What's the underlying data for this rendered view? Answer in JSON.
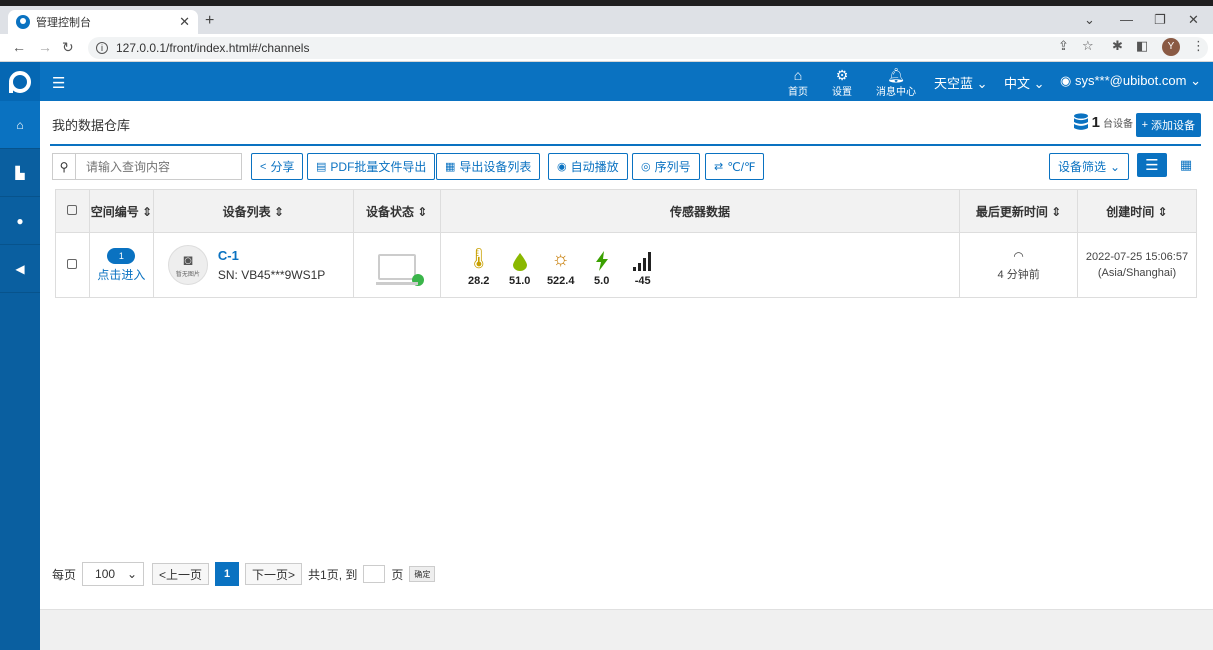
{
  "browser": {
    "tab_title": "管理控制台",
    "url": "127.0.0.1/front/index.html#/channels",
    "profile_initial": "Y"
  },
  "header": {
    "home_label": "首页",
    "settings_label": "设置",
    "messages_label": "消息中心",
    "theme_label": "天空蓝",
    "language_label": "中文",
    "user_label": "sys***@ubibot.com"
  },
  "page": {
    "title": "我的数据仓库",
    "device_count": "1",
    "device_unit": "台设备",
    "add_device_label": "添加设备"
  },
  "toolbar": {
    "search_placeholder": "请输入查询内容",
    "share_label": "分享",
    "pdf_label": "PDF批量文件导出",
    "export_label": "导出设备列表",
    "autoplay_label": "自动播放",
    "serial_label": "序列号",
    "unit_label": "℃/℉",
    "filter_label": "设备筛选"
  },
  "table": {
    "headers": {
      "space": "空间编号",
      "devices": "设备列表",
      "status": "设备状态",
      "sensors": "传感器数据",
      "updated": "最后更新时间",
      "created": "创建时间"
    },
    "rows": [
      {
        "space_no": "1",
        "space_link": "点击进入",
        "no_image": "暂无图片",
        "name": "C-1",
        "sn": "SN: VB45***9WS1P",
        "sensors": [
          {
            "icon": "thermometer-icon",
            "value": "28.2"
          },
          {
            "icon": "humidity-drop-icon",
            "value": "51.0"
          },
          {
            "icon": "light-sun-icon",
            "value": "522.4"
          },
          {
            "icon": "voltage-bolt-icon",
            "value": "5.0"
          },
          {
            "icon": "signal-bars-icon",
            "value": "-45"
          }
        ],
        "updated": "4 分钟前",
        "created_date": "2022-07-25 15:06:57",
        "created_tz": "(Asia/Shanghai)"
      }
    ]
  },
  "pagination": {
    "per_page_label": "每页",
    "per_page_value": "100",
    "prev_label": "<上一页",
    "current_page": "1",
    "next_label": "下一页>",
    "total_label": "共1页, 到",
    "page_label": "页",
    "confirm_label": "确定"
  },
  "colors": {
    "primary": "#0a72c1",
    "sidebar": "#0a5fa0",
    "online": "#3ab54a",
    "sensor_yellow": "#c8a000",
    "sensor_green": "#8ab800",
    "sensor_orange": "#c67a00",
    "sensor_bolt": "#3aa000"
  }
}
